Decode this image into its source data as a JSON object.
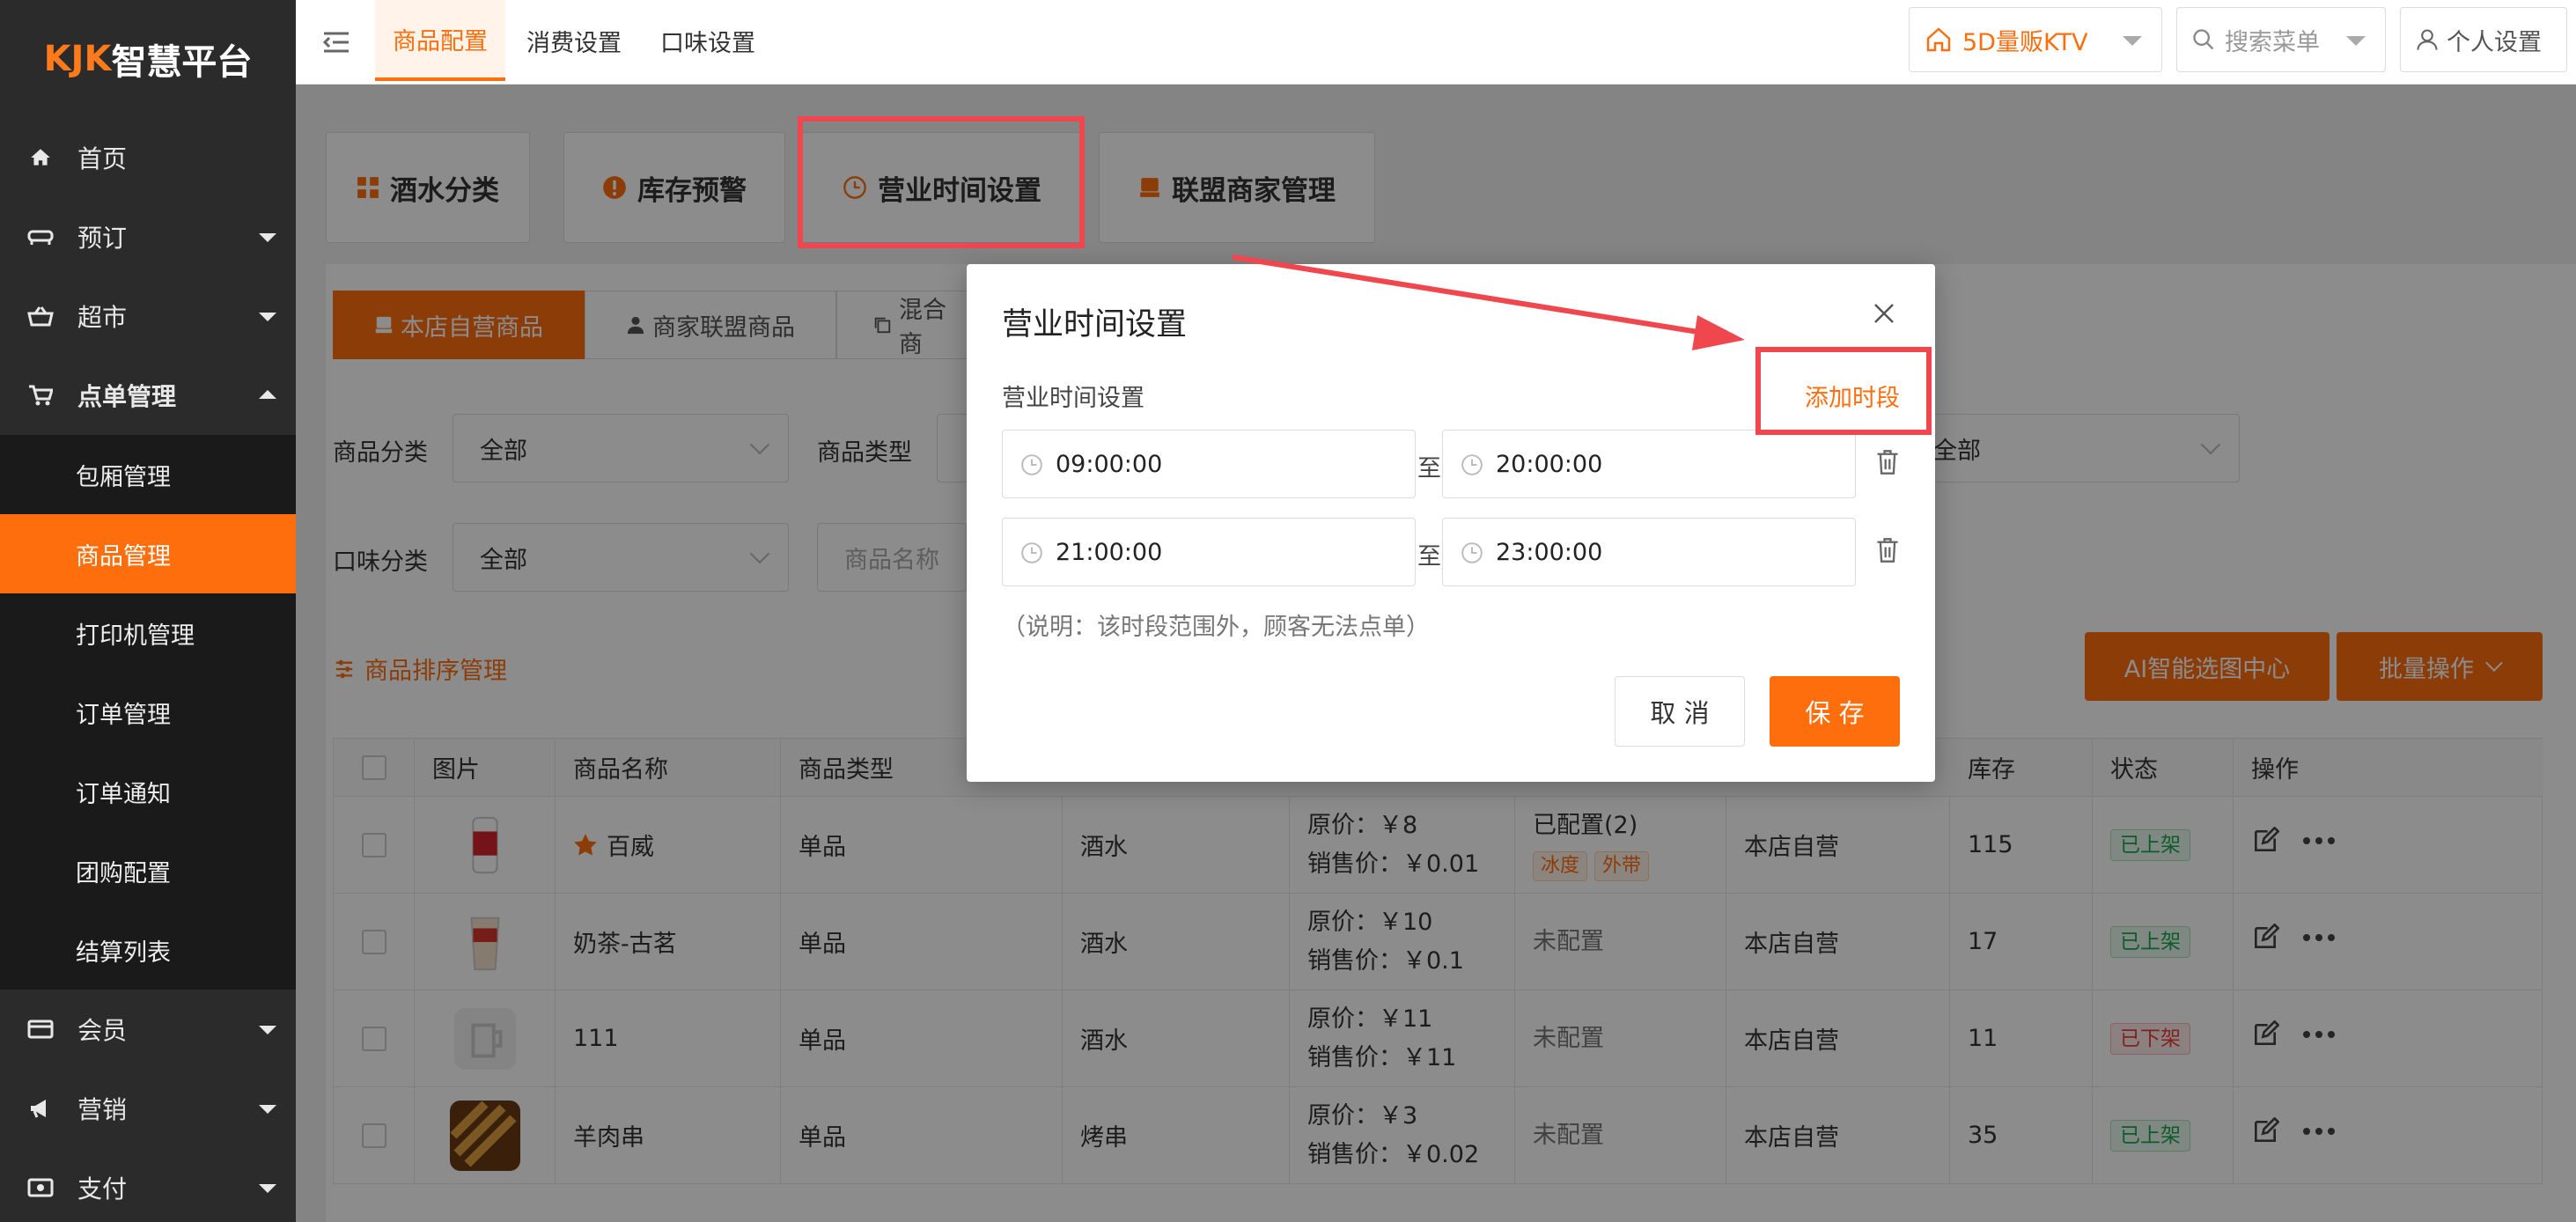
{
  "sidebar": {
    "logo": {
      "k": "KJK",
      "text": "智慧平台"
    },
    "items": [
      {
        "label": "首页",
        "icon": "home-icon"
      },
      {
        "label": "预订",
        "icon": "sofa-icon"
      },
      {
        "label": "超市",
        "icon": "basket-icon"
      },
      {
        "label": "点单管理",
        "icon": "cart-icon"
      },
      {
        "label": "会员",
        "icon": "card-icon"
      },
      {
        "label": "营销",
        "icon": "megaphone-icon"
      },
      {
        "label": "支付",
        "icon": "money-icon"
      }
    ],
    "subitems": [
      "包厢管理",
      "商品管理",
      "打印机管理",
      "订单管理",
      "订单通知",
      "团购配置",
      "结算列表"
    ]
  },
  "topbar": {
    "tabs": [
      "商品配置",
      "消费设置",
      "口味设置"
    ],
    "store": "5D量贩KTV",
    "search_placeholder": "搜索菜单",
    "personal": "个人设置"
  },
  "feature_tabs": [
    "酒水分类",
    "库存预警",
    "营业时间设置",
    "联盟商家管理"
  ],
  "sub_tabs": [
    "本店自营商品",
    "商家联盟商品",
    "混合商"
  ],
  "filters": {
    "category_label": "商品分类",
    "category_value": "全部",
    "type_label": "商品类型",
    "flavor_label": "口味分类",
    "flavor_value": "全部",
    "name_placeholder": "商品名称",
    "right_value": "全部"
  },
  "sort_link": "商品排序管理",
  "buttons": {
    "ai": "AI智能选图中心",
    "batch": "批量操作"
  },
  "table": {
    "headers": [
      "图片",
      "商品名称",
      "商品类型",
      "库存",
      "状态",
      "操作"
    ],
    "rows": [
      {
        "name": "百威",
        "type": "单品",
        "category": "酒水",
        "orig": "原价：￥8",
        "sale": "销售价：￥0.01",
        "config": "已配置(2)",
        "tags": [
          "冰度",
          "外带"
        ],
        "owner": "本店自营",
        "stock": "115",
        "status": "已上架",
        "on": true
      },
      {
        "name": "奶茶-古茗",
        "type": "单品",
        "category": "酒水",
        "orig": "原价：￥10",
        "sale": "销售价：￥0.1",
        "config": "未配置",
        "tags": [],
        "owner": "本店自营",
        "stock": "17",
        "status": "已上架",
        "on": true
      },
      {
        "name": "111",
        "type": "单品",
        "category": "酒水",
        "orig": "原价：￥11",
        "sale": "销售价：￥11",
        "config": "未配置",
        "tags": [],
        "owner": "本店自营",
        "stock": "11",
        "status": "已下架",
        "on": false
      },
      {
        "name": "羊肉串",
        "type": "单品",
        "category": "烤串",
        "orig": "原价：￥3",
        "sale": "销售价：￥0.02",
        "config": "未配置",
        "tags": [],
        "owner": "本店自营",
        "stock": "35",
        "status": "已上架",
        "on": true
      }
    ]
  },
  "modal": {
    "title": "营业时间设置",
    "subtitle": "营业时间设置",
    "add_label": "添加时段",
    "to_label": "至",
    "slots": [
      {
        "start": "09:00:00",
        "end": "20:00:00"
      },
      {
        "start": "21:00:00",
        "end": "23:00:00"
      }
    ],
    "note": "（说明：该时段范围外，顾客无法点单）",
    "cancel": "取 消",
    "save": "保 存"
  },
  "colors": {
    "accent": "#ff6e0d",
    "sidebar": "#2b2b2b",
    "highlight": "#f0474e"
  }
}
